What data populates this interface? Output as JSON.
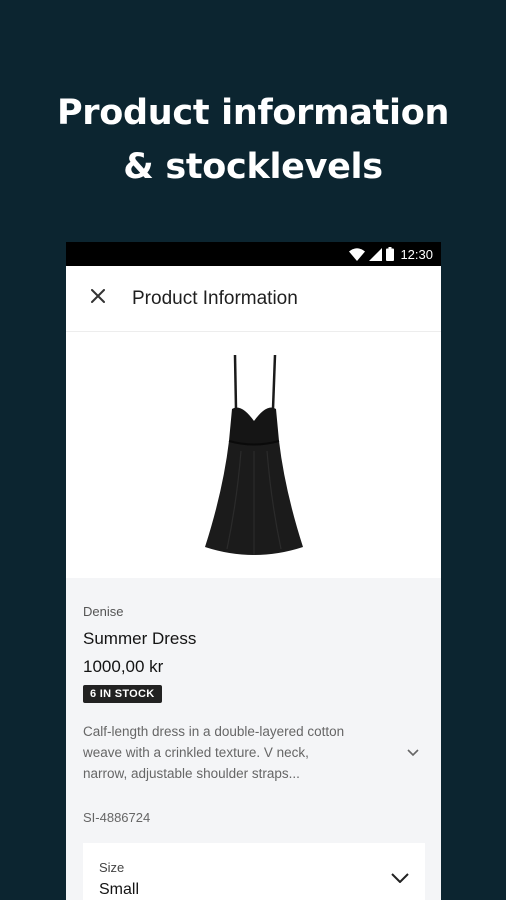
{
  "promo": {
    "line1": "Product information",
    "line2": "& stocklevels"
  },
  "status_bar": {
    "time": "12:30",
    "icons": [
      "wifi-icon",
      "signal-icon",
      "battery-icon"
    ]
  },
  "app_bar": {
    "title": "Product Information",
    "close_icon": "close-icon"
  },
  "product": {
    "image": "black-dress",
    "brand": "Denise",
    "name": "Summer Dress",
    "price": "1000,00 kr",
    "stock_badge": "6 IN STOCK",
    "description_lines": [
      "Calf-length dress in a double-layered cotton",
      "weave with a crinkled texture. V neck,",
      "narrow, adjustable shoulder straps..."
    ],
    "sku": "SI-4886724"
  },
  "size_select": {
    "label": "Size",
    "value": "Small"
  },
  "colors": {
    "background": "#0c2530",
    "status_bar": "#000000",
    "badge": "#222222",
    "info_panel": "#f4f5f7"
  }
}
